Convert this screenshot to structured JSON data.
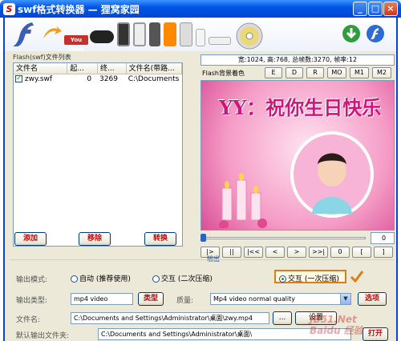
{
  "window": {
    "title": "swf格式转换器 — 狸窝家园",
    "app_icon_letter": "S",
    "minimize": "_",
    "maximize": "□",
    "close": "×"
  },
  "banner": {
    "youtube_label": "You Tube"
  },
  "file_list": {
    "group_label": "Flash(swf)文件列表",
    "columns": [
      "文件名",
      "起...",
      "终...",
      "文件名(带路..."
    ],
    "rows": [
      {
        "name": "zwy.swf",
        "start": "0",
        "end": "3269",
        "path": "C:\\Documents"
      }
    ]
  },
  "list_buttons": {
    "add": "添加",
    "remove": "移除",
    "convert": "转换"
  },
  "video_info": "宽:1024, 高:768, 总帧数:3270, 帧率:12",
  "bg_color": {
    "label": "Flash背景着色",
    "buttons": [
      "E",
      "D",
      "R",
      "MO",
      "M1",
      "M2"
    ]
  },
  "preview": {
    "banner_text": "YY：祝你生日快乐"
  },
  "frame_value": "0",
  "playback": {
    "buttons": [
      "|>",
      "||",
      "|<<",
      "<",
      ">",
      ">>|",
      "0",
      "[",
      "]"
    ]
  },
  "output": {
    "group_label": "输出",
    "mode_label": "输出模式:",
    "modes": [
      "自动 (推荐使用)",
      "交互 (二次压缩)",
      "交互 (一次压缩)"
    ],
    "selected_mode": "交互 (一次压缩)",
    "type_label": "输出类型:",
    "type_value": "mp4 video",
    "type_button": "类型",
    "quality_label": "质量:",
    "quality_value": "Mp4 video normal quality",
    "options_button": "选项",
    "filename_label": "文件名:",
    "filename_value": "C:\\Documents and Settings\\Administrator\\桌面\\zwy.mp4",
    "browse_button": "...",
    "settings_button": "设置",
    "default_folder_label": "默认输出文件夹:",
    "default_folder_value": "C:\\Documents and Settings\\Administrator\\桌面\\",
    "open_button": "打开"
  },
  "watermark": "JB51.Net Baidu 经验"
}
